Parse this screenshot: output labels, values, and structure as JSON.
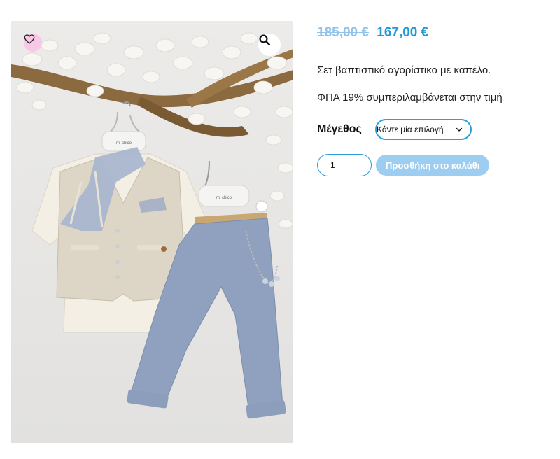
{
  "product": {
    "regular_price": "185,00 €",
    "sale_price": "167,00 €",
    "description": "Σετ βαπτιστικό αγορίστικο με καπέλο.",
    "vat_notice": "ΦΠΑ 19% συμπεριλαμβάνεται στην τιμή"
  },
  "variation": {
    "label": "Μέγεθος",
    "select_value": "Κάντε μία επιλογή"
  },
  "cart": {
    "quantity": "1",
    "add_button": "Προσθήκη στο καλάθι"
  },
  "gallery": {
    "hanger_tag_left": "mi chico",
    "hanger_tag_right": "mi chico"
  },
  "icons": {
    "wishlist": "heart-icon",
    "zoom": "search-icon",
    "select_arrow": "chevron-down-icon"
  },
  "colors": {
    "accent": "#1f9ad6",
    "old_price": "#8fc3ea",
    "button_disabled": "#9dcdf0",
    "wishlist_bg": "#f7c9e6"
  }
}
